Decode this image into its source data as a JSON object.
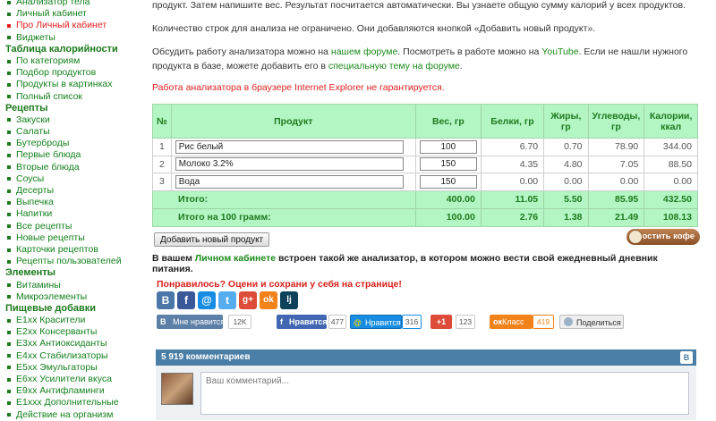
{
  "sidebar": {
    "top_items": [
      {
        "label": "Анализатор тела",
        "active": false
      },
      {
        "label": "Личный кабинет",
        "active": false
      },
      {
        "label": "Про Личный кабинет",
        "active": true
      },
      {
        "label": "Виджеты",
        "active": false
      }
    ],
    "sections": [
      {
        "heading": "Таблица калорийности",
        "items": [
          "По категориям",
          "Подбор продуктов",
          "Продукты в картинках",
          "Полный список"
        ]
      },
      {
        "heading": "Рецепты",
        "items": [
          "Закуски",
          "Салаты",
          "Бутерброды",
          "Первые блюда",
          "Вторые блюда",
          "Соусы",
          "Десерты",
          "Выпечка",
          "Напитки",
          "Все рецепты",
          "Новые рецепты",
          "Карточки рецептов",
          "Рецепты пользователей"
        ]
      },
      {
        "heading": "Элементы",
        "items": [
          "Витамины",
          "Микроэлементы"
        ]
      },
      {
        "heading": "Пищевые добавки",
        "items": [
          "E1xx Красители",
          "E2xx Консерванты",
          "E3xx Антиоксиданты",
          "E4xx Стабилизаторы",
          "E5xx Эмульгаторы",
          "E6xx Усилители вкуса",
          "E9xx Антифламинги",
          "E1xxx Дополнительные",
          "Действие на организм"
        ]
      }
    ]
  },
  "intro": {
    "line1": "продукт. Затем напишите вес. Результат посчитается автоматически. Вы узнаете общую сумму калорий у всех продуктов.",
    "line2": "Количество строк для анализа не ограничено. Они добавляются кнопкой «Добавить новый продукт».",
    "p3_a": "Обсудить работу анализатора можно на ",
    "p3_link1": "нашем форуме",
    "p3_b": ". Посмотреть в работе можно на ",
    "p3_link2": "YouTube",
    "p3_c": ". Если не нашли нужного продукта в базе, можете добавить его в ",
    "p3_link3": "специальную тему на форуме",
    "p3_d": ".",
    "warning": "Работа анализатора в браузере Internet Explorer не гарантируется."
  },
  "table": {
    "headers": [
      "№",
      "Продукт",
      "Вес, гр",
      "Белки, гр",
      "Жиры, гр",
      "Углеводы, гр",
      "Калории, ккал"
    ],
    "rows": [
      {
        "n": "1",
        "product": "Рис белый",
        "weight": "100",
        "protein": "6.70",
        "fat": "0.70",
        "carbs": "78.90",
        "kcal": "344.00"
      },
      {
        "n": "2",
        "product": "Молоко 3.2%",
        "weight": "150",
        "protein": "4.35",
        "fat": "4.80",
        "carbs": "7.05",
        "kcal": "88.50"
      },
      {
        "n": "3",
        "product": "Вода",
        "weight": "150",
        "protein": "0.00",
        "fat": "0.00",
        "carbs": "0.00",
        "kcal": "0.00"
      }
    ],
    "totals": [
      {
        "label": "Итого:",
        "weight": "400.00",
        "protein": "11.05",
        "fat": "5.50",
        "carbs": "85.95",
        "kcal": "432.50"
      },
      {
        "label": "Итого на 100 грамм:",
        "weight": "100.00",
        "protein": "2.76",
        "fat": "1.38",
        "carbs": "21.49",
        "kcal": "108.13"
      }
    ]
  },
  "buttons": {
    "add_product": "Добавить новый продукт",
    "coffee": "Угостить кофе"
  },
  "diary": {
    "a": "В вашем ",
    "link": "Личном кабинете",
    "b": " встроен такой же анализатор, в котором можно вести свой ежедневный дневник питания."
  },
  "share": {
    "liked": "Понравилось? Оцени и сохрани у себя на странице!",
    "icons": [
      {
        "name": "vk-share-icon",
        "glyph": "B",
        "color": "#4a76a8"
      },
      {
        "name": "facebook-share-icon",
        "glyph": "f",
        "color": "#3b5998"
      },
      {
        "name": "mail-share-icon",
        "glyph": "@",
        "color": "#168de2"
      },
      {
        "name": "twitter-share-icon",
        "glyph": "t",
        "color": "#55acee"
      },
      {
        "name": "googleplus-share-icon",
        "glyph": "g+",
        "color": "#dd4b39"
      },
      {
        "name": "odnoklassniki-share-icon",
        "glyph": "ok",
        "color": "#f2821a"
      },
      {
        "name": "livejournal-share-icon",
        "glyph": "lj",
        "color": "#0d425a"
      }
    ],
    "vk_like": "Мне нравится",
    "vk_count": "12K",
    "fb_like": "Нравится",
    "fb_count": "477",
    "mail_like": "Нравится",
    "mail_count": "316",
    "gplus": "+1",
    "gplus_count": "123",
    "ok_like": "Класс",
    "ok_count": "419",
    "share_button": "Поделиться"
  },
  "comments": {
    "count_label": "5 919 комментариев",
    "placeholder": "Ваш комментарий..."
  }
}
